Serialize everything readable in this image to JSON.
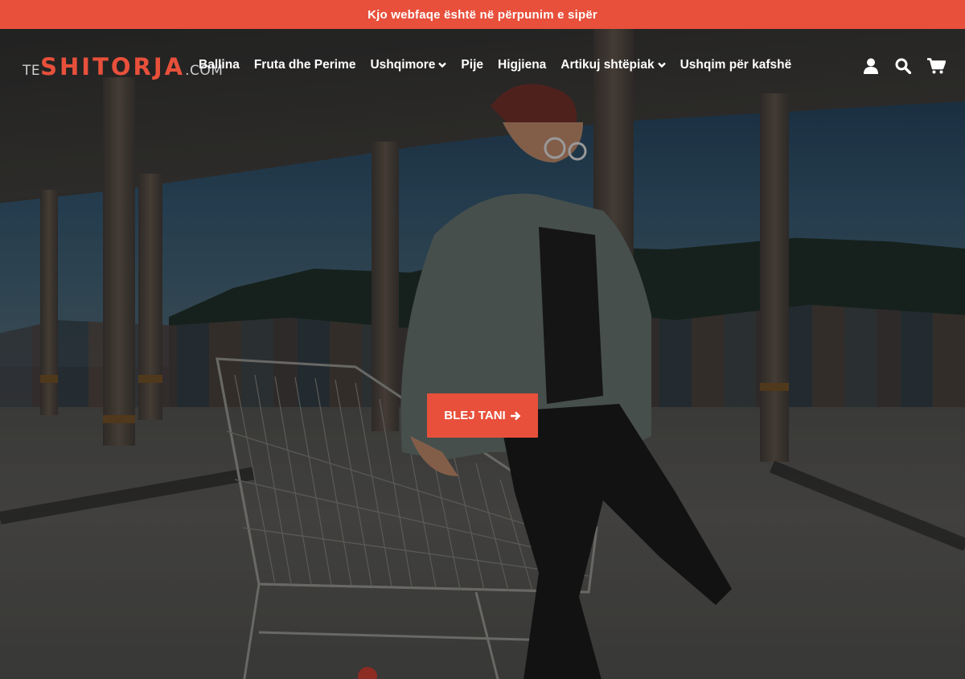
{
  "announcement": {
    "text": "Kjo webfaqe është në përpunim e sipër"
  },
  "logo": {
    "prefix": "TE",
    "main": "SHITORJA",
    "suffix": ".COM"
  },
  "nav": {
    "items": [
      {
        "label": "Ballina",
        "dropdown": false
      },
      {
        "label": "Fruta dhe Perime",
        "dropdown": false
      },
      {
        "label": "Ushqimore",
        "dropdown": true
      },
      {
        "label": "Pije",
        "dropdown": false
      },
      {
        "label": "Higjiena",
        "dropdown": false
      },
      {
        "label": "Artikuj shtëpiak",
        "dropdown": true
      },
      {
        "label": "Ushqim për kafshë",
        "dropdown": false
      }
    ]
  },
  "header_icons": [
    "user-icon",
    "search-icon",
    "cart-icon"
  ],
  "hero": {
    "cta_label": "BLEJ TANI"
  },
  "colors": {
    "accent": "#e8503b",
    "text": "#ffffff"
  }
}
